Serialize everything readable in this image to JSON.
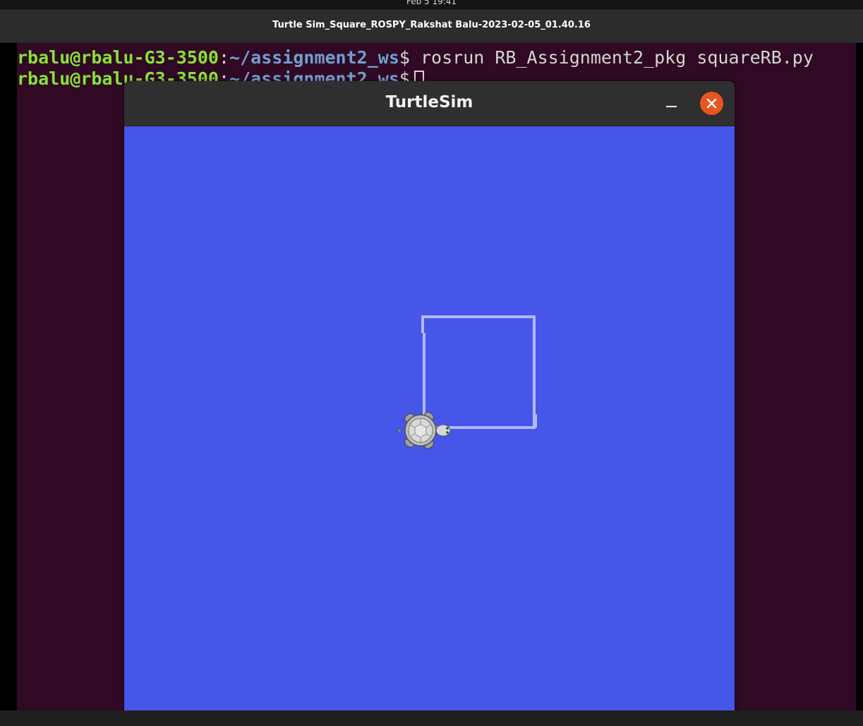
{
  "top_bar": {
    "clock": "Feb 5  19:41"
  },
  "video_window": {
    "title": "Turtle Sim_Square_ROSPY_Rakshat Balu-2023-02-05_01.40.16"
  },
  "terminal": {
    "lines": [
      {
        "user_host": "rbalu@rbalu-G3-3500",
        "colon": ":",
        "path": "~/assignment2_ws",
        "prompt_symbol": "$",
        "command": "rosrun RB_Assignment2_pkg squareRB.py"
      },
      {
        "user_host": "rbalu@rbalu-G3-3500",
        "colon": ":",
        "path": "~/assignment2_ws",
        "prompt_symbol": "$",
        "command": ""
      }
    ]
  },
  "turtlesim": {
    "title": "TurtleSim",
    "minimize_icon": "minimize-icon",
    "close_icon": "close-icon",
    "background_color": "#4556e9",
    "pen_color": "#b3b8ff",
    "close_button_color": "#e95420"
  }
}
